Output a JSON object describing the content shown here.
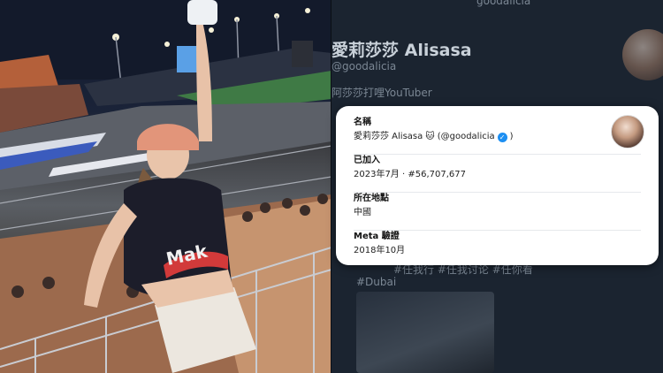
{
  "background_profile": {
    "handle_top": "goodalicia",
    "display_name": "愛莉莎莎 Alisasa",
    "handle": "@goodalicia",
    "bio_line": "阿莎莎打哩YouTuber",
    "tags_line": "#任我行 #任我讨论 #任你看",
    "hashtag": "#Dubai"
  },
  "card": {
    "rows": [
      {
        "label": "名稱",
        "value": "愛莉莎莎 Alisasa",
        "handle": "(@goodalicia"
      },
      {
        "label": "已加入",
        "value": "2023年7月 · #56,707,677"
      },
      {
        "label": "所在地點",
        "value": "中國"
      },
      {
        "label": "Meta 驗證",
        "value": "2018年10月"
      }
    ]
  },
  "colors": {
    "verified_badge": "#1d8ff2",
    "page_bg": "#1b2430"
  },
  "icons": [
    "verified-badge-icon",
    "cat-emoji-icon"
  ]
}
